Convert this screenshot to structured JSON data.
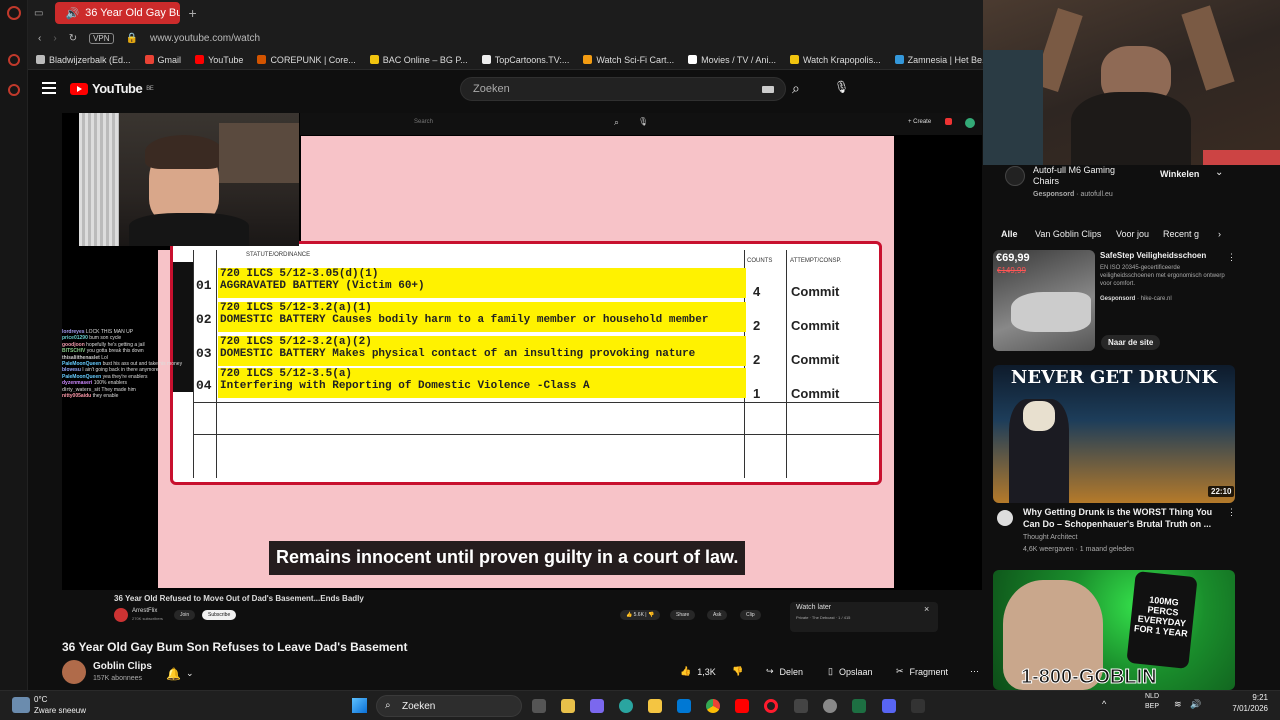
{
  "browser": {
    "tab_title": "36 Year Old Gay Bum S",
    "url": "www.youtube.com/watch",
    "vpn_label": "VPN",
    "bookmarks": [
      "Bladwijzerbalk (Ed...",
      "Gmail",
      "YouTube",
      "COREPUNK | Core...",
      "BAC Online – BG P...",
      "TopCartoons.TV:...",
      "Watch Sci-Fi Cart...",
      "Movies / TV / Ani...",
      "Watch Krapopolis...",
      "Zamnesia | Het Be..."
    ]
  },
  "youtube": {
    "logo_text": "YouTube",
    "logo_region": "BE",
    "search_placeholder": "Zoeken"
  },
  "video": {
    "inner_search": "Search",
    "inner_create": "+ Create",
    "doc_header_left": "STATUTE/ORDINANCE",
    "doc_header_counts": "COUNTS",
    "doc_header_type": "ATTEMPT/CONSP.",
    "doc_rows": [
      {
        "num": "01",
        "line1": "720 ILCS 5/12-3.05(d)(1)",
        "line2": "AGGRAVATED BATTERY (Victim 60+)",
        "count": "4",
        "type": "Commit"
      },
      {
        "num": "02",
        "line1": "720 ILCS 5/12-3.2(a)(1)",
        "line2": "DOMESTIC BATTERY Causes bodily harm to a family member or household member",
        "count": "2",
        "type": "Commit"
      },
      {
        "num": "03",
        "line1": "720 ILCS 5/12-3.2(a)(2)",
        "line2": "DOMESTIC BATTERY Makes physical contact of an insulting provoking nature",
        "count": "2",
        "type": "Commit"
      },
      {
        "num": "04",
        "line1": "720 ILCS 5/12-3.5(a)",
        "line2": "Interfering with Reporting of Domestic Violence -Class A",
        "count": "1",
        "type": "Commit"
      }
    ],
    "subtitle": "Remains innocent until proven guilty in a court of law.",
    "chat": [
      {
        "user": "lordreyes",
        "msg": "LOCK THIS MAN UP"
      },
      {
        "user": "price01290",
        "msg": "bum son cycle"
      },
      {
        "user": "goodjoon",
        "msg": "hopefully he's getting a jail"
      },
      {
        "user": "BITSCHIV",
        "msg": "you gotta break this down"
      },
      {
        "user": "thisaliithenaslet",
        "msg": "Lol"
      },
      {
        "user": "PaleMoonQueen",
        "msg": "bust his ass out and take his money"
      },
      {
        "user": "blovesu",
        "msg": "I ain't going back in there anymore"
      },
      {
        "user": "PaleMoonQueen",
        "msg": "yea they're enablers"
      },
      {
        "user": "dyzenmaseri",
        "msg": "100% enablers"
      },
      {
        "user": "dirty_waters_sit",
        "msg": "They made him"
      },
      {
        "user": "nitty005aidu",
        "msg": "they enable"
      }
    ],
    "embed": {
      "title": "36 Year Old Refused to Move Out of Dad's Basement...Ends Badly",
      "channel": "ArrestFlix",
      "subs": "270K subscribers",
      "join": "Join",
      "subscribe": "Subscribe",
      "likes": "5.6K",
      "share": "Share",
      "ask": "Ask",
      "clip": "Clip",
      "watch_later_title": "Watch later",
      "watch_later_sub": "Private · The Debcast · 1 / 415"
    }
  },
  "watch": {
    "title": "36 Year Old Gay Bum Son Refuses to Leave Dad's Basement",
    "channel": "Goblin Clips",
    "subscribers": "157K abonnees",
    "likes": "1,3K",
    "share": "Delen",
    "save": "Opslaan",
    "clip": "Fragment"
  },
  "sidebar": {
    "ad_top": {
      "title": "Autof-ull M6 Gaming Chairs",
      "sponsored": "Gesponsord",
      "domain": "autofull.eu",
      "cta": "Winkelen"
    },
    "chips": [
      "Alle",
      "Van Goblin Clips",
      "Voor jou",
      "Recent g"
    ],
    "ad_shoe": {
      "price_new": "€69,99",
      "price_old": "€149,99",
      "title": "SafeStep Veiligheidsschoen",
      "desc": "EN ISO 20345-gecertificeerde veiligheidsschoenen met ergonomisch ontwerp voor comfort.",
      "sponsored": "Gesponsord",
      "domain": "hike-care.nl",
      "cta": "Naar de site"
    },
    "video1": {
      "thumb_text": "NEVER GET DRUNK",
      "duration": "22:10",
      "title": "Why Getting Drunk is the WORST Thing You Can Do – Schopenhauer's Brutal Truth on ...",
      "channel": "Thought Architect",
      "meta": "4,6K weergaven · 1 maand geleden"
    },
    "video2": {
      "badge": "100MG PERCS EVERYDAY FOR 1 YEAR",
      "bottom": "1-800-GOBLIN"
    }
  },
  "taskbar": {
    "temp": "0°C",
    "weather": "Zware sneeuw",
    "search": "Zoeken",
    "lang": "NLD",
    "lang2": "BEP",
    "time": "9:21",
    "date": "7/01/2026"
  }
}
